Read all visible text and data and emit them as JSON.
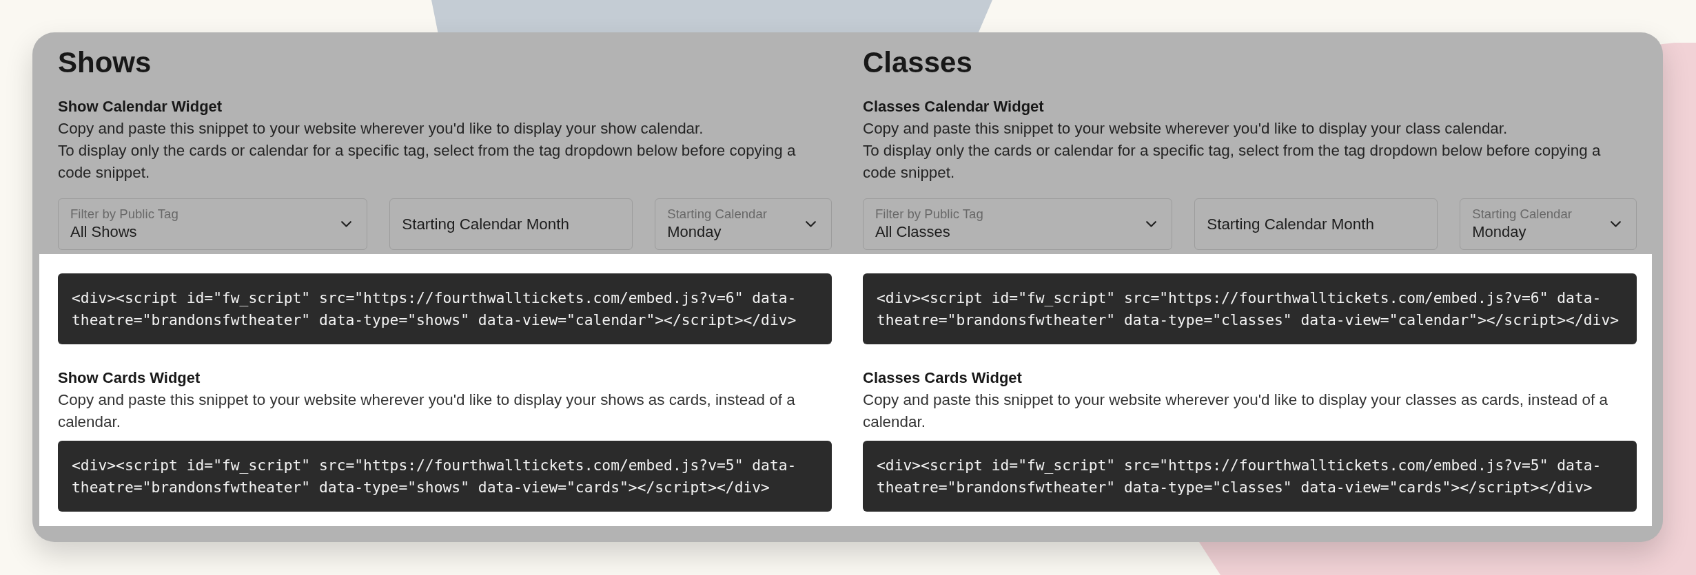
{
  "snippets_highlighted": true,
  "columns": [
    {
      "title": "Shows",
      "calendar_widget": {
        "title": "Show Calendar Widget",
        "description": [
          "Copy and paste this snippet to your website wherever you'd like to display your show calendar.",
          "To display only the cards or calendar for a specific tag, select from the tag dropdown below before copying a code snippet."
        ],
        "filters": [
          {
            "kind": "select",
            "label": "Filter by Public Tag",
            "value": "All Shows"
          },
          {
            "kind": "input",
            "placeholder": "Starting Calendar Month"
          },
          {
            "kind": "select",
            "label": "Starting Calendar",
            "value": "Monday"
          }
        ],
        "snippet": "<div><script id=\"fw_script\" src=\"https://fourthwalltickets.com/embed.js?v=6\" data-theatre=\"brandonsfwtheater\" data-type=\"shows\" data-view=\"calendar\"></script></div>"
      },
      "cards_widget": {
        "title": "Show Cards Widget",
        "description": [
          "Copy and paste this snippet to your website wherever you'd like to display your shows as cards, instead of a calendar."
        ],
        "snippet": "<div><script id=\"fw_script\" src=\"https://fourthwalltickets.com/embed.js?v=5\" data-theatre=\"brandonsfwtheater\" data-type=\"shows\" data-view=\"cards\"></script></div>"
      }
    },
    {
      "title": "Classes",
      "calendar_widget": {
        "title": "Classes Calendar Widget",
        "description": [
          "Copy and paste this snippet to your website wherever you'd like to display your class calendar.",
          "To display only the cards or calendar for a specific tag, select from the tag dropdown below before copying a code snippet."
        ],
        "filters": [
          {
            "kind": "select",
            "label": "Filter by Public Tag",
            "value": "All Classes"
          },
          {
            "kind": "input",
            "placeholder": "Starting Calendar Month"
          },
          {
            "kind": "select",
            "label": "Starting Calendar",
            "value": "Monday"
          }
        ],
        "snippet": "<div><script id=\"fw_script\" src=\"https://fourthwalltickets.com/embed.js?v=6\" data-theatre=\"brandonsfwtheater\" data-type=\"classes\" data-view=\"calendar\"></script></div>"
      },
      "cards_widget": {
        "title": "Classes Cards Widget",
        "description": [
          "Copy and paste this snippet to your website wherever you'd like to display your classes as cards, instead of a calendar."
        ],
        "snippet": "<div><script id=\"fw_script\" src=\"https://fourthwalltickets.com/embed.js?v=5\" data-theatre=\"brandonsfwtheater\" data-type=\"classes\" data-view=\"cards\"></script></div>"
      }
    }
  ]
}
